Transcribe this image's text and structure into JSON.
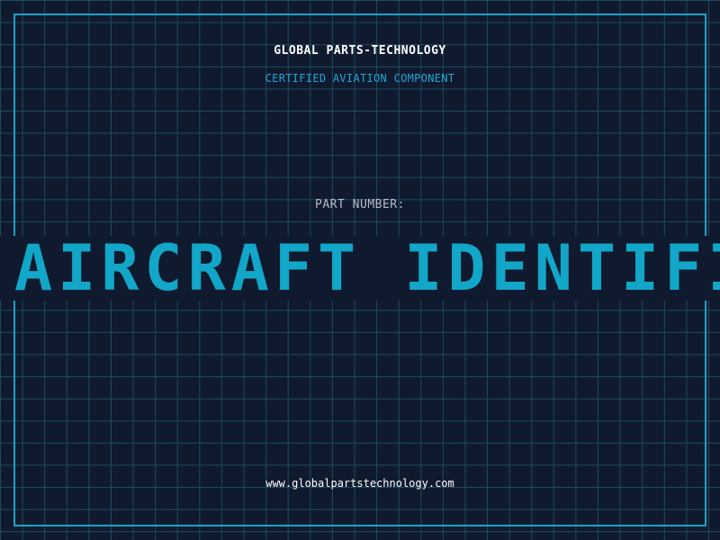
{
  "header": {
    "title": "GLOBAL PARTS-TECHNOLOGY",
    "subtitle": "CERTIFIED AVIATION COMPONENT"
  },
  "part": {
    "label": "PART NUMBER:",
    "value": "AIRCRAFT IDENTIFIC"
  },
  "footer": {
    "url": "www.globalpartstechnology.com"
  },
  "colors": {
    "background": "#101a2e",
    "grid": "#1c4a5e",
    "frame": "#1aa3c9",
    "accent": "#12a6c8",
    "title": "#ffffff",
    "label": "#b4bcc8"
  }
}
